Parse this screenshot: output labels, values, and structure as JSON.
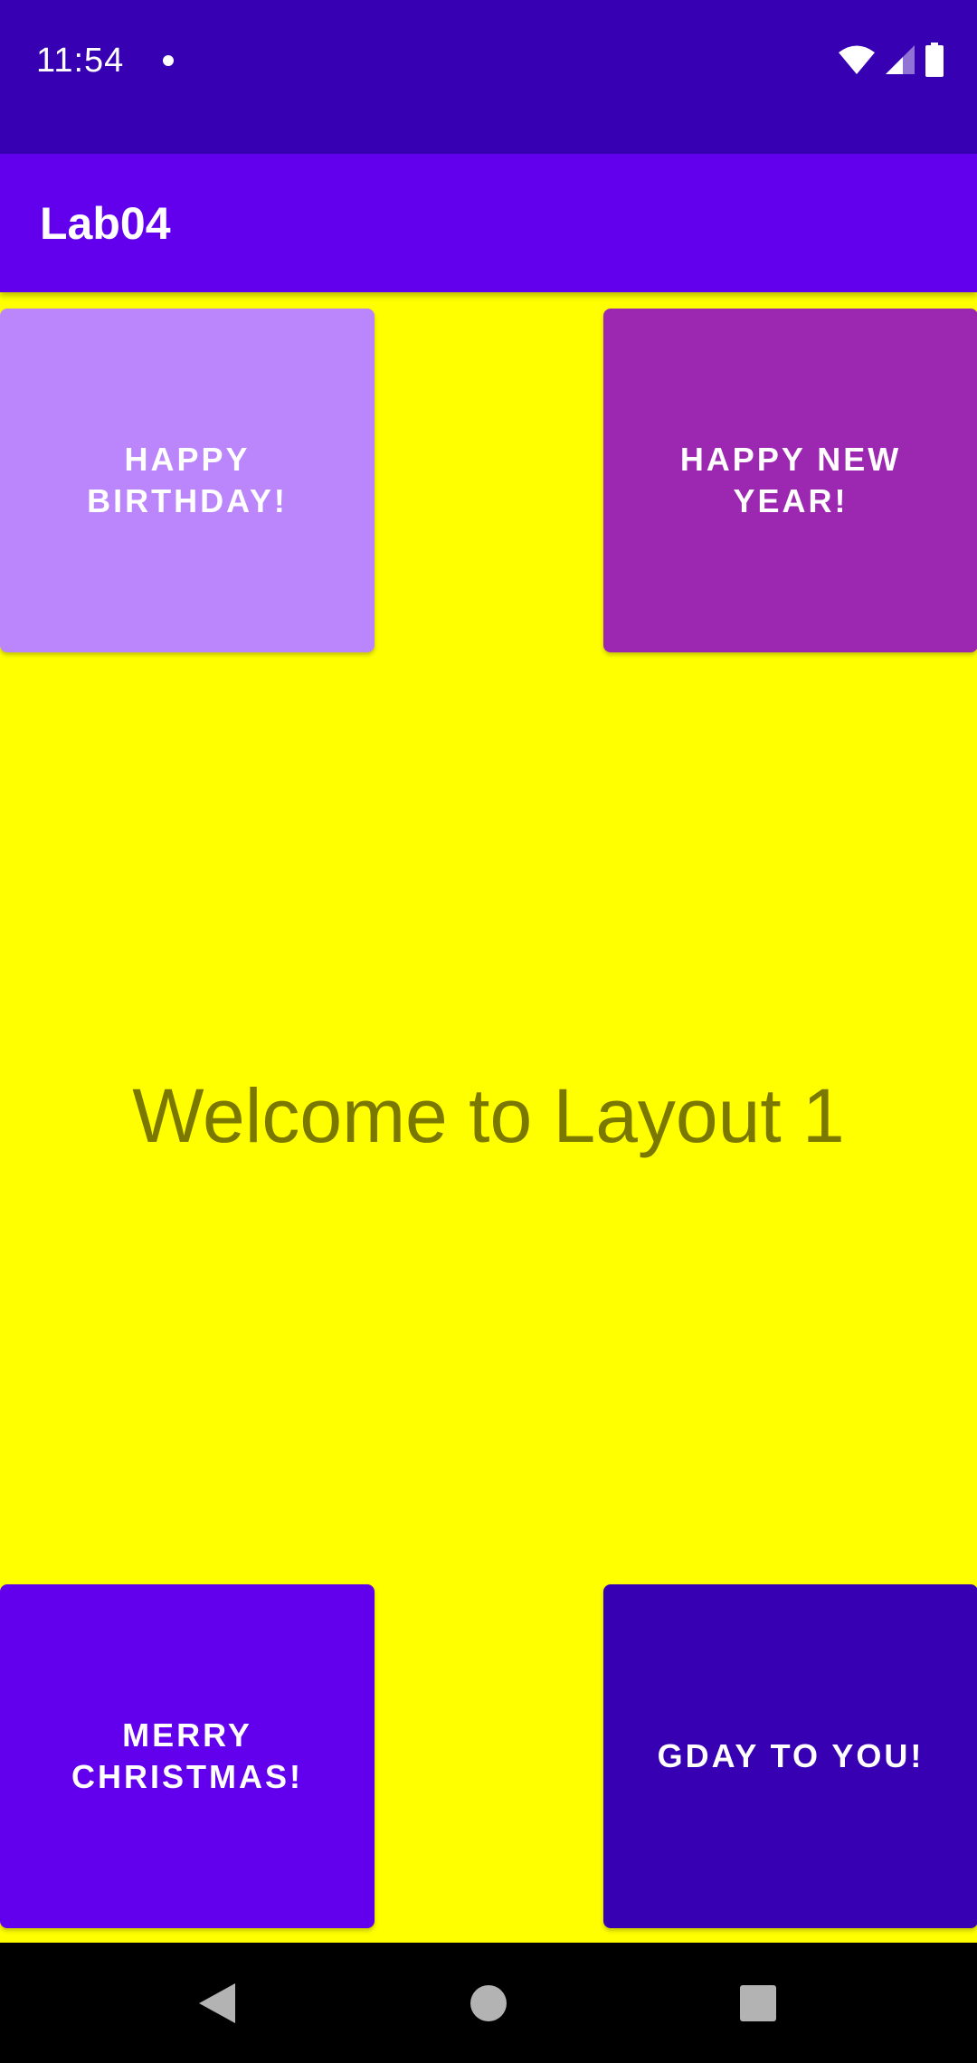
{
  "status_bar": {
    "time": "11:54",
    "bg_color": "#3700B3",
    "icons": [
      "notification-dot-icon",
      "wifi-icon",
      "cellular-signal-icon",
      "battery-icon"
    ]
  },
  "app_bar": {
    "title": "Lab04",
    "bg_color": "#6200EE"
  },
  "main": {
    "bg_color": "#FFFF00",
    "welcome_text": "Welcome to Layout 1",
    "welcome_color": "#7A7800",
    "buttons": [
      {
        "label": "HAPPY BIRTHDAY!",
        "color": "#BB86FC"
      },
      {
        "label": "HAPPY NEW YEAR!",
        "color": "#9C27B0"
      },
      {
        "label": "MERRY CHRISTMAS!",
        "color": "#6200EE"
      },
      {
        "label": "GDAY TO YOU!",
        "color": "#3700B3"
      }
    ]
  },
  "nav_bar": {
    "icons": [
      "back-icon",
      "home-icon",
      "recents-icon"
    ]
  }
}
